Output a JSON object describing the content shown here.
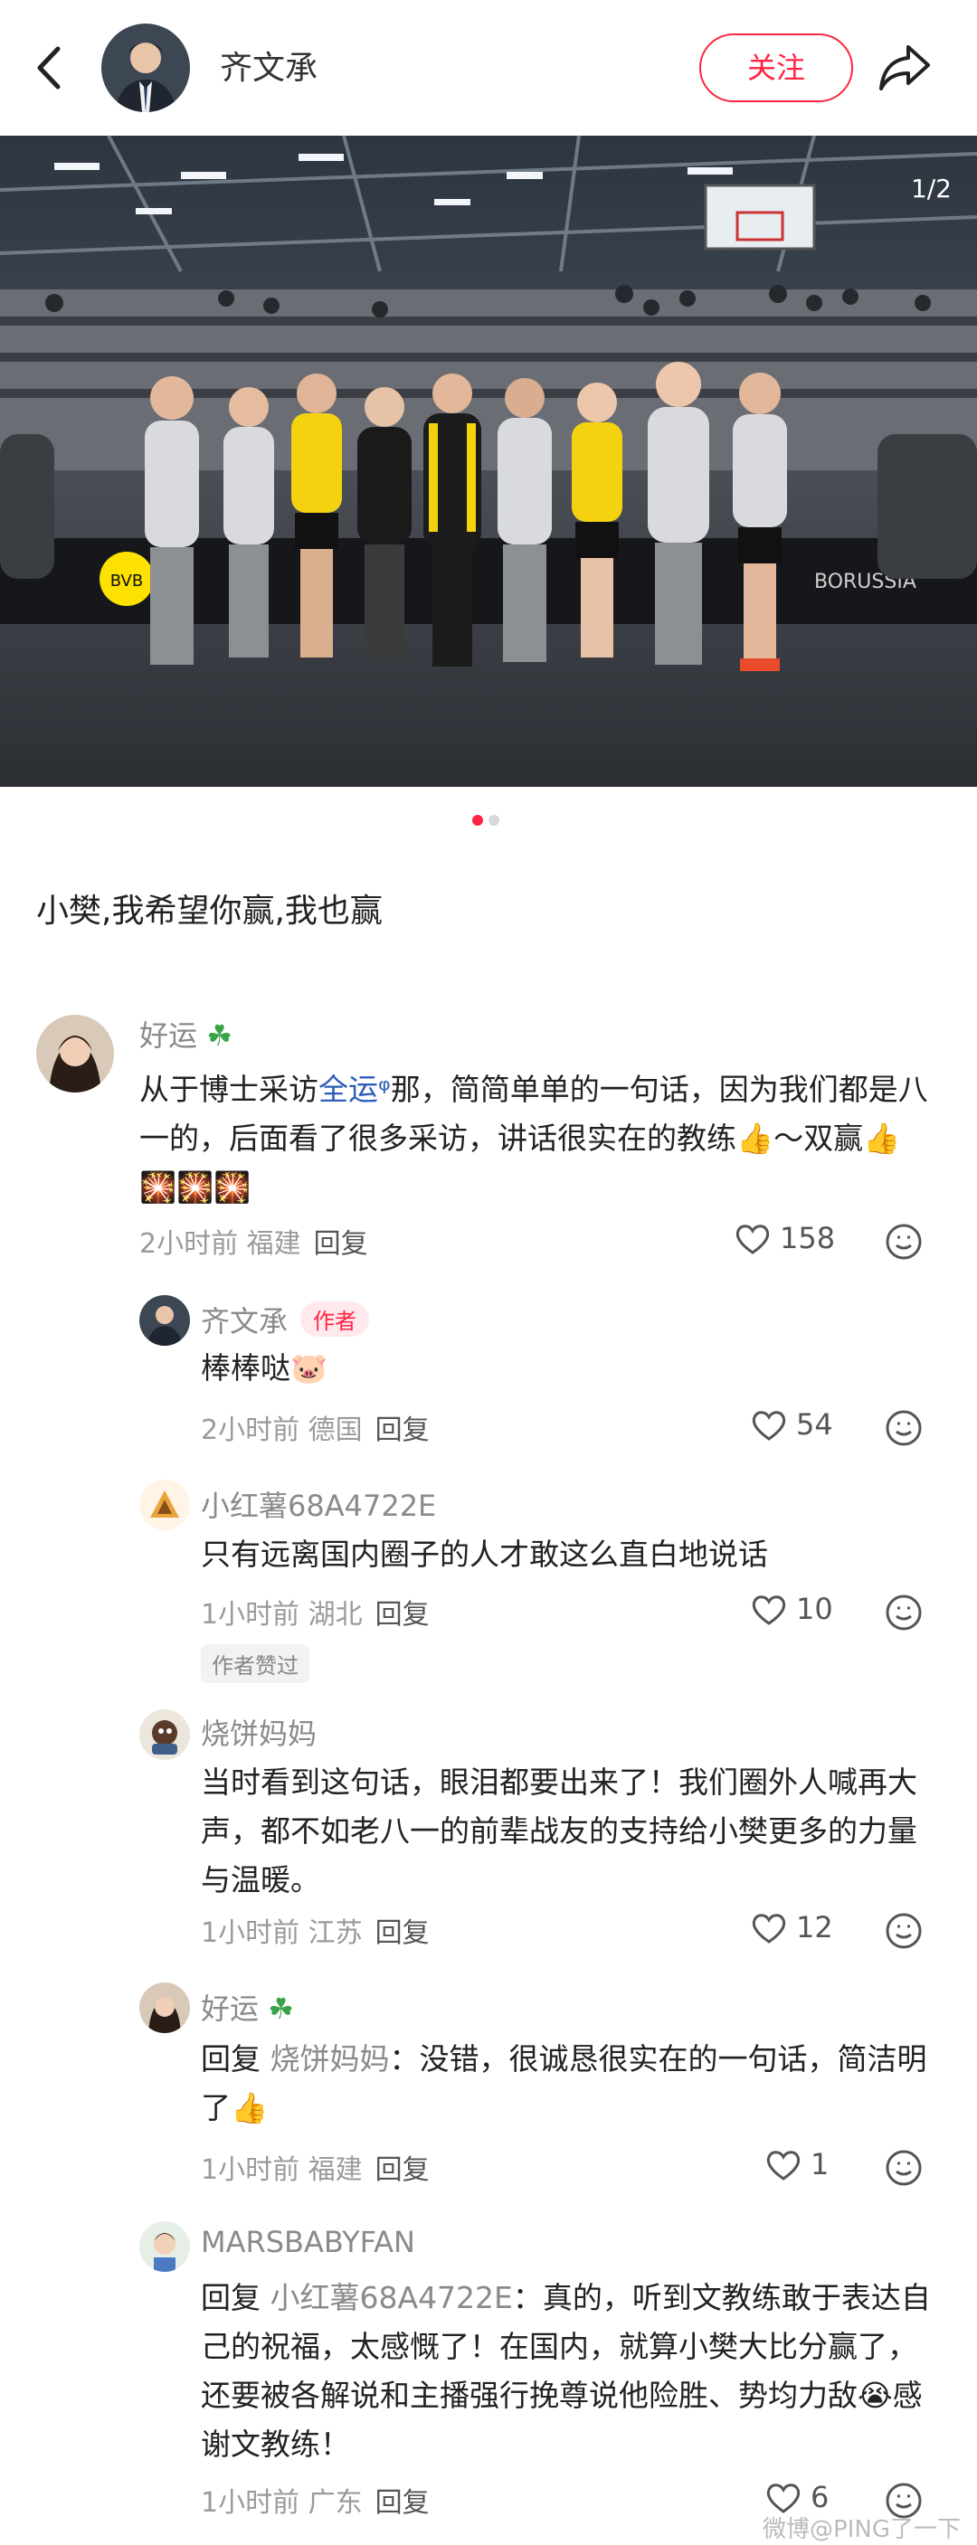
{
  "header": {
    "author_name": "齐文承",
    "follow_label": "关注"
  },
  "photo": {
    "counter": "1/2",
    "page_count": 2,
    "current_page": 1,
    "description_note": ""
  },
  "caption": "小樊,我希望你赢,我也赢",
  "comments": [
    {
      "name": "好运",
      "text_before": "从于博士采访",
      "topic": "全运",
      "text_after": "那，简简单单的一句话，因为我们都是八一的，后面看了很多采访，讲话很实在的教练",
      "text_mid": "～双赢",
      "time": "2小时前",
      "location": "福建",
      "reply_label": "回复",
      "likes": "158"
    },
    {
      "name": "齐文承",
      "author_tag": "作者",
      "text": "棒棒哒",
      "time": "2小时前",
      "location": "德国",
      "reply_label": "回复",
      "likes": "54"
    },
    {
      "name": "小红薯68A4722E",
      "text": "只有远离国内圈子的人才敢这么直白地说话",
      "time": "1小时前",
      "location": "湖北",
      "reply_label": "回复",
      "likes": "10",
      "liked_tag": "作者赞过"
    },
    {
      "name": "烧饼妈妈",
      "text": "当时看到这句话，眼泪都要出来了！我们圈外人喊再大声，都不如老八一的前辈战友的支持给小樊更多的力量与温暖。",
      "time": "1小时前",
      "location": "江苏",
      "reply_label": "回复",
      "likes": "12"
    },
    {
      "name": "好运",
      "reply_prefix": "回复",
      "mention": "烧饼妈妈",
      "text": "：没错，很诚恳很实在的一句话，简洁明了",
      "time": "1小时前",
      "location": "福建",
      "reply_label": "回复",
      "likes": "1"
    },
    {
      "name": "MARSBABYFAN",
      "reply_prefix": "回复",
      "mention": "小红薯68A4722E",
      "text": "：真的，听到文教练敢于表达自己的祝福，太感慨了！在国内，就算小樊大比分赢了，还要被各解说和主播强行挽尊说他险胜、势均力敌",
      "text_end": "感谢文教练！",
      "time": "1小时前",
      "location": "广东",
      "reply_label": "回复",
      "likes": "6"
    }
  ],
  "watermark": "微博@PING了一下",
  "colors": {
    "accent": "#ff2442",
    "topic_link": "#2c5db7",
    "meta_gray": "#9a9a9a"
  }
}
